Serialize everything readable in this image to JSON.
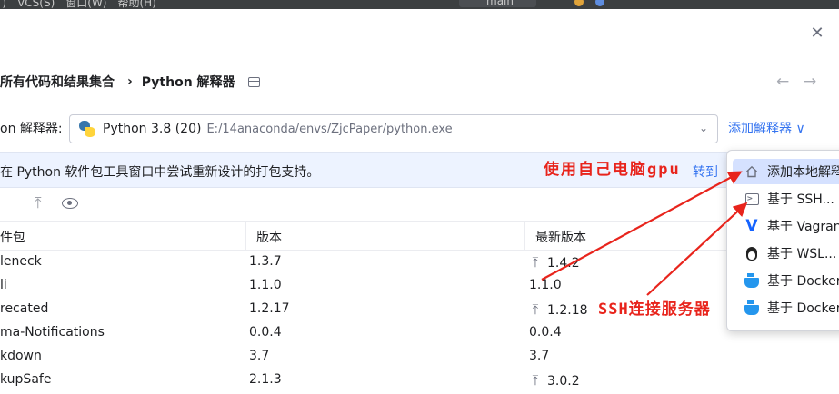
{
  "menubar": {
    "menu_text": " ) VCS(S) 窗口(W) 帮助(H)",
    "branch": "main"
  },
  "dialog": {
    "breadcrumb": {
      "parent": "所有代码和结果集合",
      "separator": "›",
      "current": "Python 解释器"
    },
    "nav": {
      "back": "←",
      "forward": "→"
    },
    "close": "✕",
    "interpreter": {
      "label": "on 解释器:",
      "name": "Python 3.8 (20)",
      "path": "E:/14anaconda/envs/ZjcPaper/python.exe",
      "add_link": "添加解释器 ∨"
    },
    "banner": {
      "text": "在 Python 软件包工具窗口中尝试重新设计的打包支持。",
      "link": "转到"
    },
    "toolbar": {
      "up_icon": "⤒"
    },
    "table": {
      "headers": [
        "件包",
        "版本",
        "最新版本"
      ],
      "rows": [
        {
          "name": "leneck",
          "version": "1.3.7",
          "upgrade": true,
          "latest": "1.4.2"
        },
        {
          "name": "li",
          "version": "1.1.0",
          "upgrade": false,
          "latest": "1.1.0"
        },
        {
          "name": "recated",
          "version": "1.2.17",
          "upgrade": true,
          "latest": "1.2.18"
        },
        {
          "name": "ma-Notifications",
          "version": "0.0.4",
          "upgrade": false,
          "latest": "0.0.4"
        },
        {
          "name": "kdown",
          "version": "3.7",
          "upgrade": false,
          "latest": "3.7"
        },
        {
          "name": "kupSafe",
          "version": "2.1.3",
          "upgrade": true,
          "latest": "3.0.2"
        }
      ]
    },
    "popup": {
      "items": [
        {
          "label": "添加本地解释器",
          "icon": "home-icon",
          "selected": true
        },
        {
          "label": "基于 SSH...",
          "icon": "terminal-icon",
          "selected": false
        },
        {
          "label": "基于 Vagrant...",
          "icon": "vagrant-icon",
          "selected": false
        },
        {
          "label": "基于 WSL...",
          "icon": "linux-icon",
          "selected": false
        },
        {
          "label": "基于 Docker...",
          "icon": "docker-icon",
          "selected": false
        },
        {
          "label": "基于 Docker Compose...",
          "icon": "docker-icon",
          "selected": false
        }
      ]
    }
  },
  "annotations": {
    "local_gpu": "使用自己电脑gpu",
    "ssh": "SSH连接服务器",
    "color": "#e8241c"
  },
  "colors": {
    "accent": "#3574f0",
    "banner_bg": "#edf3ff",
    "selected_bg": "#d5e1ff"
  }
}
